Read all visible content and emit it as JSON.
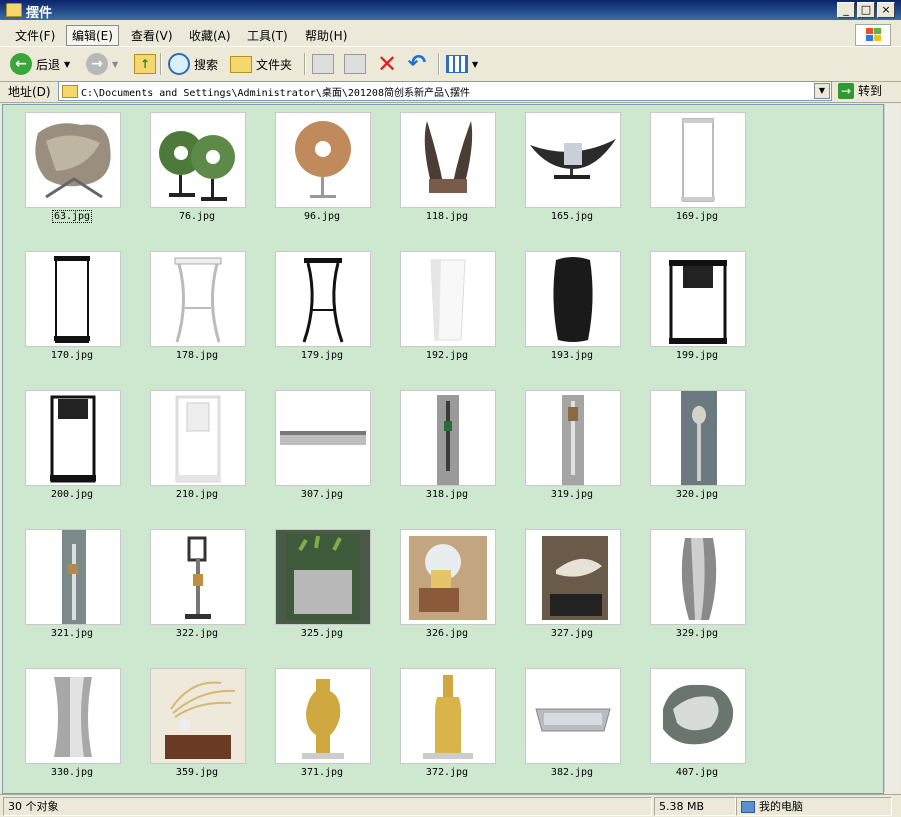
{
  "window": {
    "title": "摆件"
  },
  "menu": [
    "文件(F)",
    "编辑(E)",
    "查看(V)",
    "收藏(A)",
    "工具(T)",
    "帮助(H)"
  ],
  "toolbar": {
    "back_label": "后退",
    "search_label": "搜索",
    "folders_label": "文件夹"
  },
  "address": {
    "label": "地址(D)",
    "path": "C:\\Documents and Settings\\Administrator\\桌面\\201208简创系新产品\\摆件",
    "go_label": "转到"
  },
  "files": [
    {
      "name": "63.jpg"
    },
    {
      "name": "76.jpg"
    },
    {
      "name": "96.jpg"
    },
    {
      "name": "118.jpg"
    },
    {
      "name": "165.jpg"
    },
    {
      "name": "169.jpg"
    },
    {
      "name": "170.jpg"
    },
    {
      "name": "178.jpg"
    },
    {
      "name": "179.jpg"
    },
    {
      "name": "192.jpg"
    },
    {
      "name": "193.jpg"
    },
    {
      "name": "199.jpg"
    },
    {
      "name": "200.jpg"
    },
    {
      "name": "210.jpg"
    },
    {
      "name": "307.jpg"
    },
    {
      "name": "318.jpg"
    },
    {
      "name": "319.jpg"
    },
    {
      "name": "320.jpg"
    },
    {
      "name": "321.jpg"
    },
    {
      "name": "322.jpg"
    },
    {
      "name": "325.jpg"
    },
    {
      "name": "326.jpg"
    },
    {
      "name": "327.jpg"
    },
    {
      "name": "329.jpg"
    },
    {
      "name": "330.jpg"
    },
    {
      "name": "359.jpg"
    },
    {
      "name": "371.jpg"
    },
    {
      "name": "372.jpg"
    },
    {
      "name": "382.jpg"
    },
    {
      "name": "407.jpg"
    }
  ],
  "status": {
    "count": "30 个对象",
    "size": "5.38 MB",
    "location": "我的电脑"
  },
  "colors": {
    "content_bg": "#cde8cf",
    "titlebar": "#0a246a"
  }
}
